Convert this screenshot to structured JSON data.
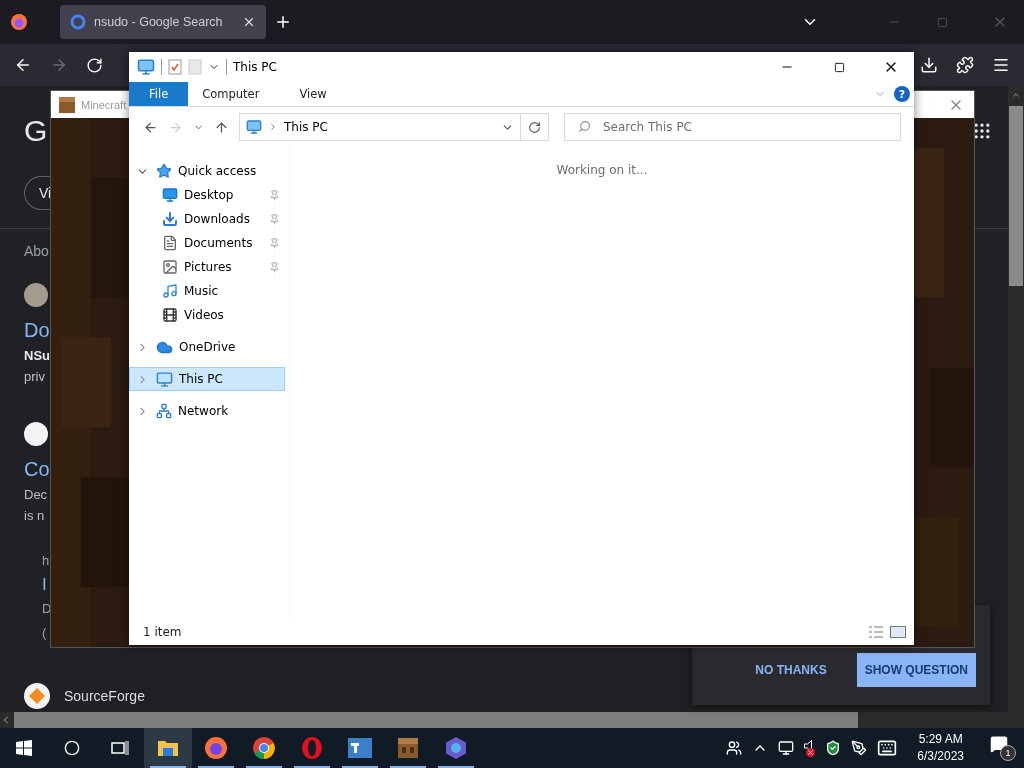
{
  "browser": {
    "tabs": [
      {
        "title": "nsudo - Google Search",
        "selected": true
      }
    ],
    "can_go_back": true,
    "can_go_forward": false,
    "page": {
      "logo": "G",
      "chip": "Vi",
      "about": "Abo",
      "results": [
        {
          "title": "Do",
          "lines": [
            {
              "text": "NSu",
              "kind": "bold"
            },
            {
              "text": "priv",
              "kind": "plain"
            }
          ]
        },
        {
          "title": "Co",
          "lines": [
            {
              "text": "Dec",
              "kind": "plain"
            },
            {
              "text": "is n",
              "kind": "plain"
            }
          ],
          "sub_lines": [
            {
              "text": "h",
              "kind": "plain"
            },
            {
              "text": "I",
              "kind": "link"
            },
            {
              "text": "D",
              "kind": "plain"
            },
            {
              "text": "(",
              "kind": "plain"
            }
          ]
        }
      ],
      "site": "SourceForge"
    },
    "popup": {
      "buttons": [
        {
          "label": "NO THANKS",
          "kind": "text"
        },
        {
          "label": "SHOW QUESTION",
          "kind": "filled"
        }
      ]
    }
  },
  "minecraft_window": {
    "title": "Minecraft"
  },
  "explorer": {
    "title": "This PC",
    "ribbon_tabs": [
      {
        "label": "File",
        "kind": "menu"
      },
      {
        "label": "Computer",
        "kind": "tab"
      },
      {
        "label": "View",
        "kind": "tab"
      }
    ],
    "help": "?",
    "can_go_back": true,
    "can_go_forward": false,
    "address": "This PC",
    "search": {
      "placeholder": "Search This PC"
    },
    "nav": [
      {
        "label": "Quick access",
        "expanded": true,
        "selected": false,
        "children": [
          {
            "label": "Desktop",
            "pinned": true,
            "selected": false
          },
          {
            "label": "Downloads",
            "pinned": true,
            "selected": false
          },
          {
            "label": "Documents",
            "pinned": true,
            "selected": false
          },
          {
            "label": "Pictures",
            "pinned": true,
            "selected": false
          },
          {
            "label": "Music",
            "pinned": false,
            "selected": false
          },
          {
            "label": "Videos",
            "pinned": false,
            "selected": false
          }
        ]
      },
      {
        "label": "OneDrive",
        "expanded": false,
        "selected": false
      },
      {
        "label": "This PC",
        "expanded": false,
        "selected": true
      },
      {
        "label": "Network",
        "expanded": false,
        "selected": false
      }
    ],
    "status": "Working on it...",
    "item_count": "1 item"
  },
  "taskbar": {
    "apps": [
      {
        "selected": true,
        "running": true
      },
      {
        "selected": false,
        "running": true
      },
      {
        "selected": false,
        "running": true
      },
      {
        "selected": false,
        "running": true
      },
      {
        "selected": false,
        "running": true
      },
      {
        "selected": false,
        "running": true
      },
      {
        "selected": false,
        "running": true
      }
    ],
    "volume_muted": true,
    "time": "5:29 AM",
    "date": "6/3/2023",
    "notifications": "1"
  }
}
